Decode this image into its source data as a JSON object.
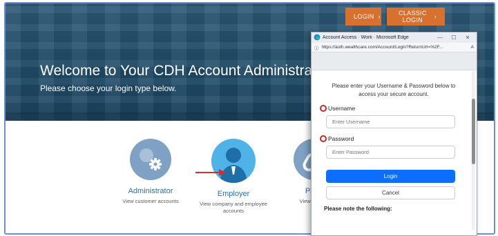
{
  "header": {
    "login_label": "LOGIN",
    "classic_login_label": "CLASSIC LOGIN",
    "accent": "#d8702e"
  },
  "hero": {
    "title": "Welcome to Your CDH Account Administration Plat",
    "subtitle": "Please choose your login type below."
  },
  "cards": [
    {
      "title": "Administrator",
      "desc": "View customer accounts",
      "icon": "gear-icon"
    },
    {
      "title": "Employer",
      "desc": "View company and employee accounts",
      "icon": "person-icon"
    },
    {
      "title": "Partn",
      "desc": "View Partner",
      "icon": "link-icon"
    }
  ],
  "popup": {
    "window_title": "Account Access · Work · Microsoft Edge",
    "url": "https://auth.wealthcare.com/Account/Login?ReturnUrl=%2F...",
    "instructions": "Please enter your Username & Password below to access your secure account.",
    "username_label": "Username",
    "username_placeholder": "Enter Username",
    "password_label": "Password",
    "password_placeholder": "Enter Password",
    "login_button": "Login",
    "cancel_button": "Cancel",
    "note_heading": "Please note the following:",
    "primary_color": "#0d6efd",
    "highlight_color": "#c62828"
  }
}
